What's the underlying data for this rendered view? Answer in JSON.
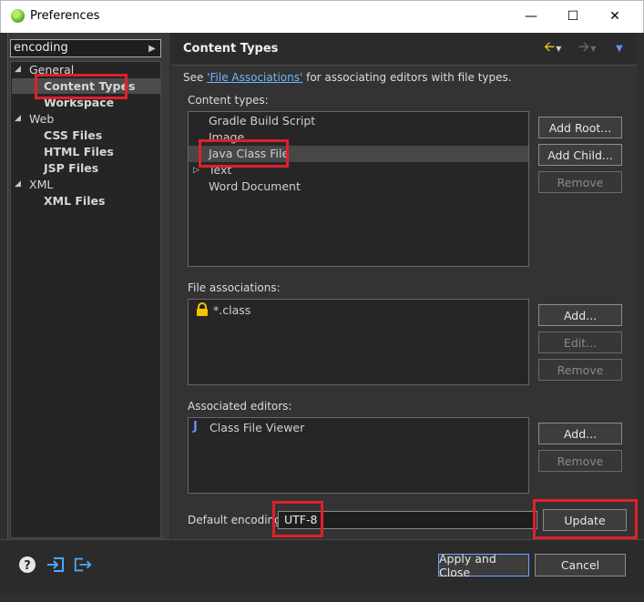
{
  "window": {
    "title": "Preferences",
    "controls": {
      "minimize": "—",
      "maximize": "☐",
      "close": "✕"
    }
  },
  "sidebar": {
    "filter": {
      "value": "encoding"
    },
    "tree": [
      {
        "label": "General",
        "expanded": true,
        "children": [
          {
            "label": "Content Types",
            "selected": true
          },
          {
            "label": "Workspace"
          }
        ]
      },
      {
        "label": "Web",
        "expanded": true,
        "children": [
          {
            "label": "CSS Files"
          },
          {
            "label": "HTML Files"
          },
          {
            "label": "JSP Files"
          }
        ]
      },
      {
        "label": "XML",
        "expanded": true,
        "children": [
          {
            "label": "XML Files"
          }
        ]
      }
    ]
  },
  "page": {
    "title": "Content Types",
    "intro": {
      "prefix": "See ",
      "link": "'File Associations'",
      "suffix": " for associating editors with file types."
    },
    "content_types": {
      "label": "Content types:",
      "items": [
        "Gradle Build Script",
        "Image",
        "Java Class File",
        "Text",
        "Word Document"
      ],
      "selected": "Java Class File",
      "buttons": {
        "add_root": "Add Root...",
        "add_child": "Add Child...",
        "remove": "Remove"
      }
    },
    "file_associations": {
      "label": "File associations:",
      "items": [
        "*.class"
      ],
      "buttons": {
        "add": "Add...",
        "edit": "Edit...",
        "remove": "Remove"
      }
    },
    "associated_editors": {
      "label": "Associated editors:",
      "items": [
        "Class File Viewer"
      ],
      "buttons": {
        "add": "Add...",
        "remove": "Remove"
      }
    },
    "default_encoding": {
      "label": "Default encoding:",
      "value": "UTF-8",
      "update_button": "Update"
    }
  },
  "footer": {
    "apply_close": "Apply and Close",
    "cancel": "Cancel"
  },
  "colors": {
    "highlight_box": "#e0202a",
    "link": "#6fb6ff",
    "nav_back_arrow": "#f0c020",
    "nav_menu_arrow": "#6a8cff"
  },
  "icons": [
    "app-icon",
    "lock-icon",
    "java-class-icon",
    "help-icon",
    "import-icon",
    "export-icon",
    "back-arrow-icon",
    "forward-arrow-icon",
    "view-menu-icon"
  ]
}
